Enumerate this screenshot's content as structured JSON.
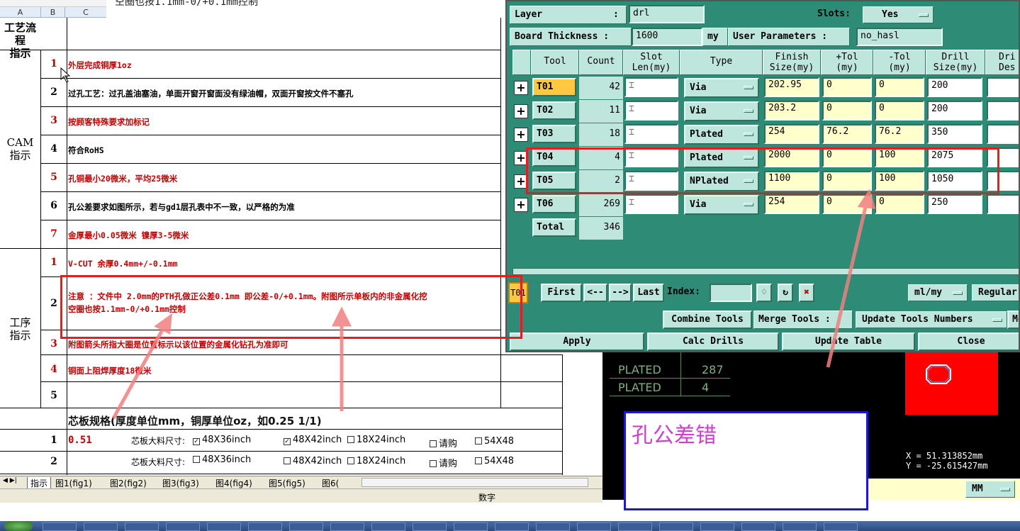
{
  "sheet": {
    "top_note": "空圈也按1.1mm-0/+0.1mm控制",
    "col_headers": [
      "A",
      "B",
      "C"
    ],
    "section_process": "工艺流程\n指示",
    "section_cam": "CAM\n指示",
    "section_step": "工序\n指示",
    "cam_rows": [
      {
        "num": "1",
        "text": "外层完成铜厚1oz",
        "red": true
      },
      {
        "num": "2",
        "text": "过孔工艺：过孔盖油塞油，单面开窗开窗面没有绿油帽，双面开窗按文件不塞孔",
        "red": false
      },
      {
        "num": "3",
        "text": "按顾客特殊要求加标记",
        "red": true
      },
      {
        "num": "4",
        "text": "符合RoHS",
        "red": false
      },
      {
        "num": "5",
        "text": "孔铜最小20微米，平均25微米",
        "red": true
      },
      {
        "num": "6",
        "text": "孔公差要求如图所示，若与gd1层孔表中不一致，以严格的为准",
        "red": false
      },
      {
        "num": "7",
        "text": "金厚最小0.05微米 镍厚3-5微米",
        "red": true
      }
    ],
    "step_rows": [
      {
        "num": "1",
        "text": "V-CUT 余厚0.4mm+/-0.1mm",
        "red": true
      },
      {
        "num": "2",
        "text": "注意 ：文件中 2.0mm的PTH孔做正公差0.1mm 即公差-0/+0.1mm。附图所示单板内的非金属化挖",
        "text2": "空圈也按1.1mm-0/+0.1mm控制",
        "red": true
      },
      {
        "num": "3",
        "text": "附图箭头所指大圈是位置标示以该位置的金属化钻孔为准即可",
        "red": true
      },
      {
        "num": "4",
        "text": "铜面上阻焊厚度18微米",
        "red": true
      },
      {
        "num": "5",
        "text": "",
        "red": false
      }
    ],
    "core_spec_title": "芯板规格(厚度单位mm，铜厚单位oz，如0.25 1/1)",
    "core_rows": [
      {
        "num": "1",
        "val": "0.51",
        "label": "芯板大料尺寸:",
        "opts": [
          "48X36inch",
          "48X42inch",
          "18X24inch",
          "请购",
          "54X48"
        ],
        "checked": [
          true,
          true,
          false,
          false,
          false
        ]
      },
      {
        "num": "2",
        "val": "",
        "label": "芯板大料尺寸:",
        "opts": [
          "48X36inch",
          "48X42inch",
          "18X24inch",
          "请购",
          "54X48"
        ],
        "checked": [
          false,
          false,
          false,
          false,
          false
        ]
      }
    ],
    "tabs": [
      "指示",
      "图1(fig1)",
      "图2(fig2)",
      "图3(fig3)",
      "图4(fig4)",
      "图5(fig5)",
      "图6("
    ],
    "status_text": "数字"
  },
  "drill": {
    "layer_label": "Layer",
    "layer_value": "drl",
    "slots_label": "Slots:",
    "slots_value": "Yes",
    "thickness_label": "Board Thickness :",
    "thickness_value": "1600",
    "thickness_unit": "my",
    "user_params_label": "User Parameters :",
    "user_params_value": "no_hasl",
    "headers": [
      "Tool",
      "Count",
      "Slot\nLen(my)",
      "Type",
      "Finish\nSize(my)",
      "+Tol\n(my)",
      "-Tol\n(my)",
      "Drill\nSize(my)",
      "Dri\nDes"
    ],
    "rows": [
      {
        "tool": "T01",
        "count": "42",
        "type": "Via",
        "finish": "202.95",
        "ptol": "0",
        "mtol": "0",
        "drill": "200",
        "active": true
      },
      {
        "tool": "T02",
        "count": "11",
        "type": "Via",
        "finish": "203.2",
        "ptol": "0",
        "mtol": "0",
        "drill": "200",
        "active": false
      },
      {
        "tool": "T03",
        "count": "18",
        "type": "Plated",
        "finish": "254",
        "ptol": "76.2",
        "mtol": "76.2",
        "drill": "350",
        "active": false
      },
      {
        "tool": "T04",
        "count": "4",
        "type": "Plated",
        "finish": "2000",
        "ptol": "0",
        "mtol": "100",
        "drill": "2075",
        "active": false
      },
      {
        "tool": "T05",
        "count": "2",
        "type": "NPlated",
        "finish": "1100",
        "ptol": "0",
        "mtol": "100",
        "drill": "1050",
        "active": false
      },
      {
        "tool": "T06",
        "count": "269",
        "type": "Via",
        "finish": "254",
        "ptol": "0",
        "mtol": "0",
        "drill": "250",
        "active": false
      }
    ],
    "total_label": "Total",
    "total_count": "346",
    "nav_current": "T01",
    "nav_first": "First",
    "nav_prev": "<--",
    "nav_next": "-->",
    "nav_last": "Last",
    "index_label": "Index:",
    "units_value": "ml/my",
    "regular_label": "Regular",
    "combine_label": "Combine Tools",
    "merge_label": "Merge Tools :",
    "update_numbers_label": "Update Tools Numbers",
    "more_label": "Mo",
    "apply_label": "Apply",
    "calc_label": "Calc Drills",
    "update_table_label": "Update Table",
    "close_label": "Close"
  },
  "graphic": {
    "rows": [
      {
        "type": "PLATED",
        "count": "287"
      },
      {
        "type": "PLATED",
        "count": "4"
      }
    ],
    "x_readout": "X =  51.313852mm",
    "y_readout": "Y = -25.615427mm",
    "unit_select": "MM"
  },
  "annotation": {
    "error_text": "孔公差错",
    "accent_red": "#e02020",
    "box_blue": "#1a1acc"
  }
}
